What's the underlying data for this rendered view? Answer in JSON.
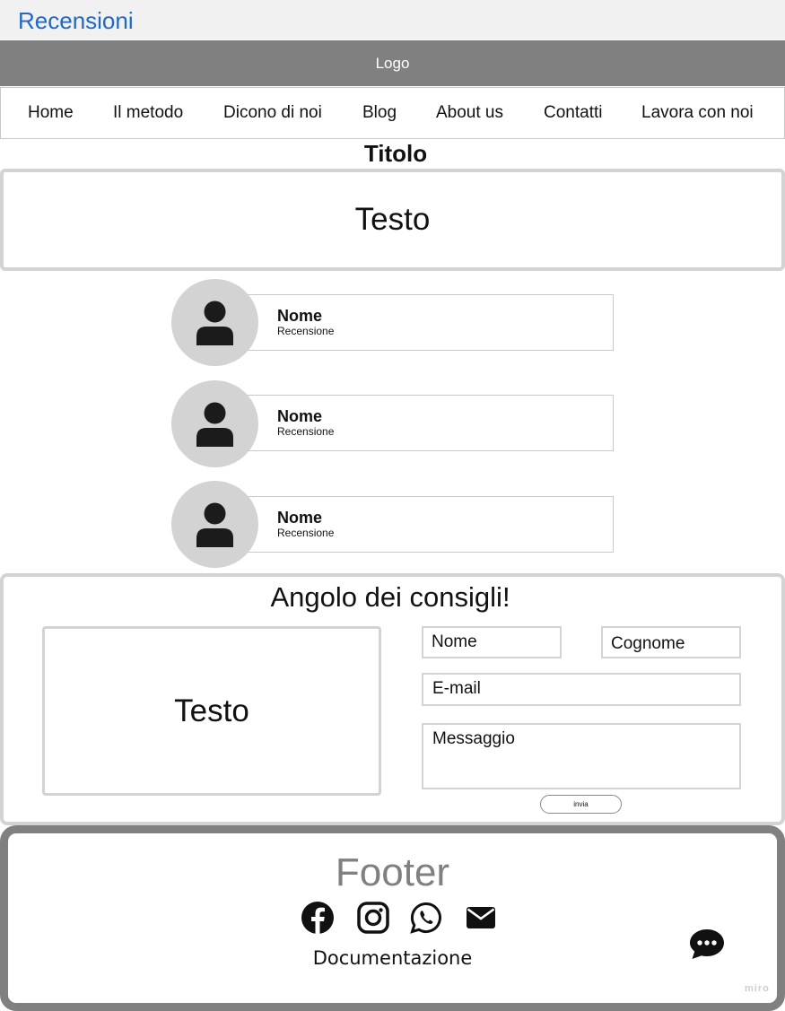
{
  "header": {
    "page_name": "Recensioni",
    "logo": "Logo"
  },
  "nav": {
    "items": [
      "Home",
      "Il metodo",
      "Dicono di noi",
      "Blog",
      "About us",
      "Contatti",
      "Lavora con noi"
    ]
  },
  "main": {
    "title": "Titolo",
    "text": "Testo"
  },
  "reviews": [
    {
      "name": "Nome",
      "text": "Recensione",
      "avatar_icon": "user-icon"
    },
    {
      "name": "Nome",
      "text": "Recensione",
      "avatar_icon": "user-icon"
    },
    {
      "name": "Nome",
      "text": "Recensione",
      "avatar_icon": "user-icon"
    }
  ],
  "advice": {
    "title": "Angolo dei consigli!",
    "text": "Testo",
    "form": {
      "name_placeholder": "Nome",
      "surname_placeholder": "Cognome",
      "email_placeholder": "E-mail",
      "message_placeholder": "Messaggio",
      "send_label": "invia"
    }
  },
  "footer": {
    "title": "Footer",
    "social_icons": [
      "facebook-icon",
      "instagram-icon",
      "whatsapp-icon",
      "mail-icon"
    ],
    "doc_link": "Documentazione",
    "chat_icon": "chat-icon",
    "watermark": "miro"
  },
  "colors": {
    "page_name": "#2168c5",
    "logo_bar": "#808080",
    "border_light": "#d3d3d3",
    "footer_border": "#808080"
  }
}
